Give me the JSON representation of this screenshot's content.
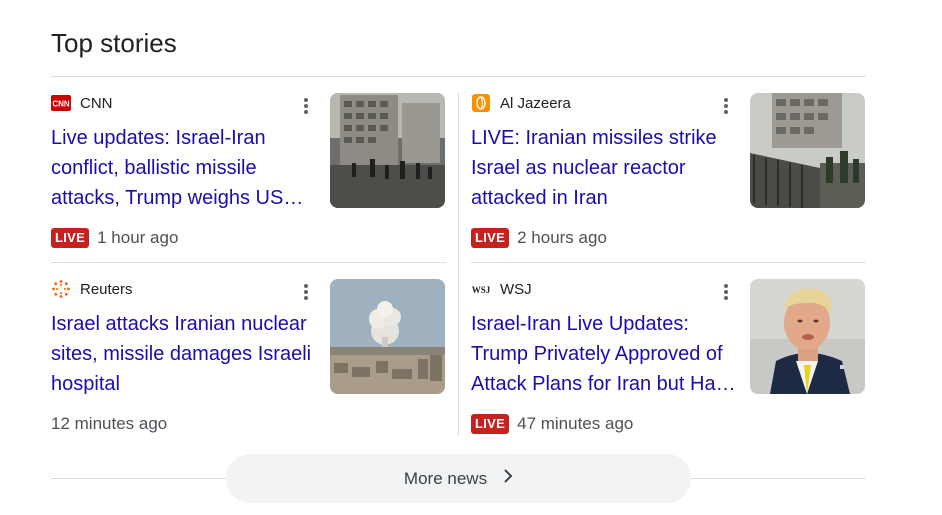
{
  "section": {
    "title": "Top stories",
    "more_label": "More news"
  },
  "stories": [
    {
      "source": "CNN",
      "logo": "CNN",
      "logo_color": "#cc0000",
      "headline": "Live updates: Israel-Iran conflict, ballistic missile attacks, Trump weighs US involvement",
      "live": "LIVE",
      "time": "1 hour ago",
      "thumb": "damaged-building-street-scene"
    },
    {
      "source": "Al Jazeera",
      "logo": "al-jazeera-flame-icon",
      "logo_color": "#fa9000",
      "headline": "LIVE: Iranian missiles strike Israel as nuclear reactor attacked in Iran",
      "live": "LIVE",
      "time": "2 hours ago",
      "thumb": "damaged-building-soldiers-scene"
    },
    {
      "source": "Reuters",
      "logo": "reuters-dots-icon",
      "logo_color": "#fa6400",
      "headline": "Israel attacks Iranian nuclear sites, missile damages Israeli hospital",
      "live": "",
      "time": "12 minutes ago",
      "thumb": "smoke-plume-city-scene"
    },
    {
      "source": "WSJ",
      "logo": "WSJ",
      "logo_color": "#222222",
      "headline": "Israel-Iran Live Updates: Trump Privately Approved of Attack Plans for Iran but Has Held Off",
      "live": "LIVE",
      "time": "47 minutes ago",
      "thumb": "man-in-suit-portrait"
    }
  ]
}
